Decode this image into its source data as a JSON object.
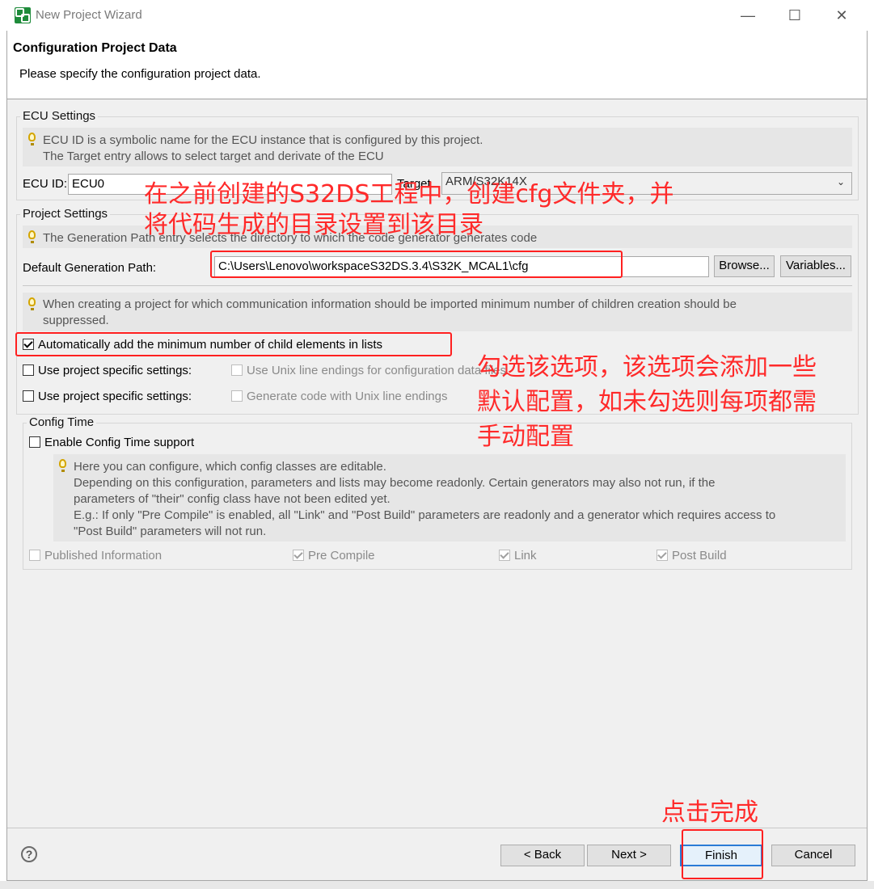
{
  "window": {
    "title": "New Project Wizard",
    "minimize_glyph": "—",
    "maximize_glyph": "☐",
    "close_glyph": "✕"
  },
  "header": {
    "title": "Configuration Project Data",
    "subtitle": "Please specify the configuration project data."
  },
  "ecu_settings": {
    "group_label": "ECU Settings",
    "info_line1": "ECU ID is a symbolic name for the ECU instance that is configured by this project.",
    "info_line2": "The Target entry allows to select target and derivate of the ECU",
    "ecu_id_label": "ECU ID:",
    "ecu_id_value": "ECU0",
    "target_label": "Target",
    "target_value": "ARM/S32K14X"
  },
  "project_settings": {
    "group_label": "Project Settings",
    "info": "The Generation Path entry selects the directory to which the code generator generates code",
    "path_label": "Default Generation Path:",
    "path_value": "C:\\Users\\Lenovo\\workspaceS32DS.3.4\\S32K_MCAL1\\cfg",
    "browse_label": "Browse...",
    "variables_label": "Variables...",
    "children_info_line1": "When creating a project for which communication information should be imported minimum number of children creation should be",
    "children_info_line2": "suppressed.",
    "auto_add_label": "Automatically add the minimum number of child elements in lists",
    "use_specific_1": "Use project specific settings:",
    "unix_line_endings_cfg": "Use Unix line endings for configuration data files",
    "use_specific_2": "Use project specific settings:",
    "unix_line_endings_code": "Generate code with Unix line endings"
  },
  "config_time": {
    "group_label": "Config Time",
    "enable_label": "Enable Config Time support",
    "info_line1": "Here you can configure, which config classes are editable.",
    "info_line2": "Depending on this configuration, parameters and lists may become readonly. Certain generators may also not run, if the",
    "info_line3": "parameters of \"their\" config class have not been edited yet.",
    "info_line4": "E.g.: If only \"Pre Compile\" is enabled, all \"Link\" and \"Post Build\" parameters are readonly and a generator which requires access to",
    "info_line5": "\"Post Build\" parameters will not run.",
    "published_info": "Published Information",
    "pre_compile": "Pre Compile",
    "link": "Link",
    "post_build": "Post Build"
  },
  "buttons": {
    "help_glyph": "?",
    "back": "< Back",
    "next": "Next >",
    "finish": "Finish",
    "cancel": "Cancel"
  },
  "annotations": {
    "note1_line1": "在之前创建的S32DS工程中，创建cfg文件夹，并",
    "note1_line2": "将代码生成的目录设置到该目录",
    "note2_line1": "勾选该选项，该选项会添加一些",
    "note2_line2": "默认配置，如未勾选则每项都需",
    "note2_line3": "手动配置",
    "note3": "点击完成"
  },
  "colors": {
    "annotation_red": "#ff2a2a",
    "window_bg": "#f0f0f0",
    "info_bg": "#e6e6e6"
  },
  "icons": [
    "app-icon",
    "lightbulb-icon",
    "help-icon"
  ]
}
